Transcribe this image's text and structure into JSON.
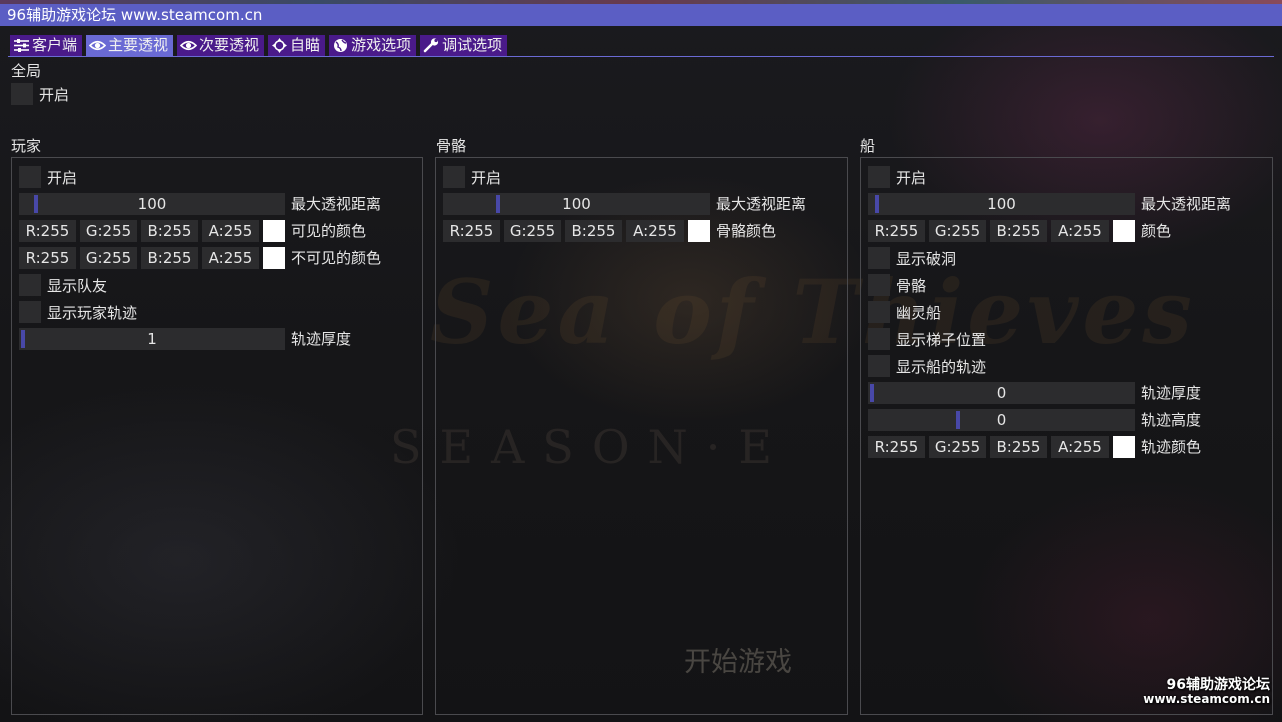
{
  "window": {
    "title": "96辅助游戏论坛 www.steamcom.cn"
  },
  "tabs": [
    {
      "label": "客户端",
      "icon": "sliders-icon"
    },
    {
      "label": "主要透视",
      "icon": "eye-icon"
    },
    {
      "label": "次要透视",
      "icon": "eye-icon"
    },
    {
      "label": "自瞄",
      "icon": "crosshair-icon"
    },
    {
      "label": "游戏选项",
      "icon": "globe-icon"
    },
    {
      "label": "调试选项",
      "icon": "wrench-icon"
    }
  ],
  "active_tab": "主要透视",
  "global": {
    "section_title": "全局",
    "enable_label": "开启"
  },
  "player": {
    "title": "玩家",
    "enable_label": "开启",
    "max_distance": {
      "value": "100",
      "label": "最大透视距离"
    },
    "visible_color": {
      "r": "R:255",
      "g": "G:255",
      "b": "B:255",
      "a": "A:255",
      "label": "可见的颜色",
      "swatch": "#ffffff"
    },
    "invisible_color": {
      "r": "R:255",
      "g": "G:255",
      "b": "B:255",
      "a": "A:255",
      "label": "不可见的颜色",
      "swatch": "#ffffff"
    },
    "show_teammates_label": "显示队友",
    "show_trail_label": "显示玩家轨迹",
    "trail_thickness": {
      "value": "1",
      "label": "轨迹厚度"
    }
  },
  "skeleton": {
    "title": "骨骼",
    "enable_label": "开启",
    "max_distance": {
      "value": "100",
      "label": "最大透视距离"
    },
    "color": {
      "r": "R:255",
      "g": "G:255",
      "b": "B:255",
      "a": "A:255",
      "label": "骨骼颜色",
      "swatch": "#ffffff"
    }
  },
  "ship": {
    "title": "船",
    "enable_label": "开启",
    "max_distance": {
      "value": "100",
      "label": "最大透视距离"
    },
    "color": {
      "r": "R:255",
      "g": "G:255",
      "b": "B:255",
      "a": "A:255",
      "label": "颜色",
      "swatch": "#ffffff"
    },
    "show_holes_label": "显示破洞",
    "skeleton_label": "骨骼",
    "ghost_ship_label": "幽灵船",
    "show_ladder_label": "显示梯子位置",
    "show_ship_trail_label": "显示船的轨迹",
    "trail_thickness": {
      "value": "0",
      "label": "轨迹厚度"
    },
    "trail_height": {
      "value": "0",
      "label": "轨迹高度"
    },
    "trail_color": {
      "r": "R:255",
      "g": "G:255",
      "b": "B:255",
      "a": "A:255",
      "label": "轨迹颜色",
      "swatch": "#ffffff"
    }
  },
  "background": {
    "game_logo": "Sea of Thieves",
    "season_text": "SEASON·E",
    "start_game": "开始游戏"
  },
  "watermark": {
    "line1": "96辅助游戏论坛",
    "line2": "www.steamcom.cn"
  },
  "colors": {
    "accent": "#5b5ec4",
    "tab": "#4a1a8a",
    "tab_active": "#6a6ad4",
    "widget_bg": "#2c2c2e",
    "slider_grab": "#4848a8"
  }
}
